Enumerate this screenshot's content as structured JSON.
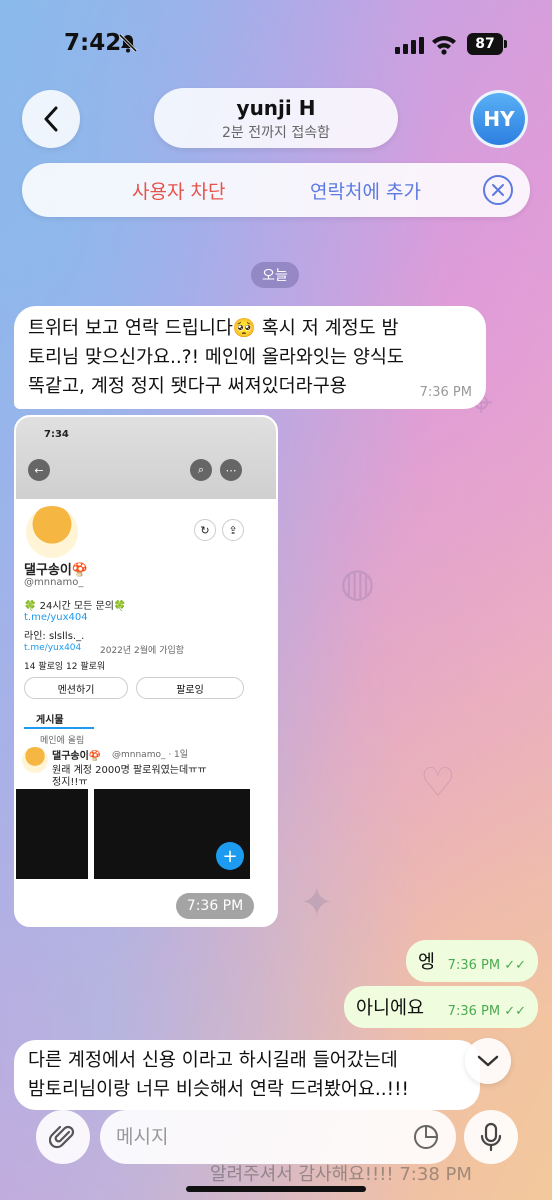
{
  "status_bar": {
    "time": "7:42",
    "battery": "87"
  },
  "header": {
    "name": "yunji H",
    "last_seen": "2분 전까지 접속함",
    "avatar_initials": "HY"
  },
  "actions": {
    "block": "사용자 차단",
    "add_contact": "연락처에 추가"
  },
  "date_chip": "오늘",
  "messages": {
    "msg1": {
      "line1": "트위터 보고 연락 드립니다🥺 혹시 저 계정도 밤",
      "line2": "토리님 맞으신가요..?! 메인에 올라와잇는 양식도",
      "line3": "똑같고, 계정 정지 됏다구 써져있더라구용",
      "time": "7:36 PM"
    },
    "image": {
      "time": "7:36 PM",
      "inner": {
        "clock": "7:34",
        "display_name": "댈구송이🍄",
        "handle": "@mnnamo_",
        "bio_line1": "🍀 24시간 모든 문의🍀",
        "bio_link": "t.me/yux404",
        "bio_line3": "라인: slslls._.",
        "meta_link": "t.me/yux404",
        "meta_joined": "2022년 2월에 가입함",
        "following": "14 팔로잉",
        "followers": "12 팔로워",
        "mention_btn": "멘션하기",
        "follow_btn": "팔로잉",
        "tab_posts": "게시물",
        "pinned": "메인에 올림",
        "tweet_name": "댈구송이🍄",
        "tweet_handle": "@mnnamo_ · 1일",
        "tweet_line1": "원래 계정 2000명 팔로워였는데ㅠㅠ",
        "tweet_line2": "정지!!ㅠ"
      }
    },
    "out1": {
      "text": "엥",
      "time": "7:36 PM"
    },
    "out2": {
      "text": "아니에요",
      "time": "7:36 PM"
    },
    "msg3": {
      "line1": "다른 계정에서 신용 이라고 하시길래 들어갔는데",
      "line2": "밤토리님이랑 너무 비슷해서 연락 드려봤어요..!!!"
    },
    "peek": "알려주셔서 감사해요!!!!   7:38 PM"
  },
  "input": {
    "placeholder": "메시지"
  }
}
